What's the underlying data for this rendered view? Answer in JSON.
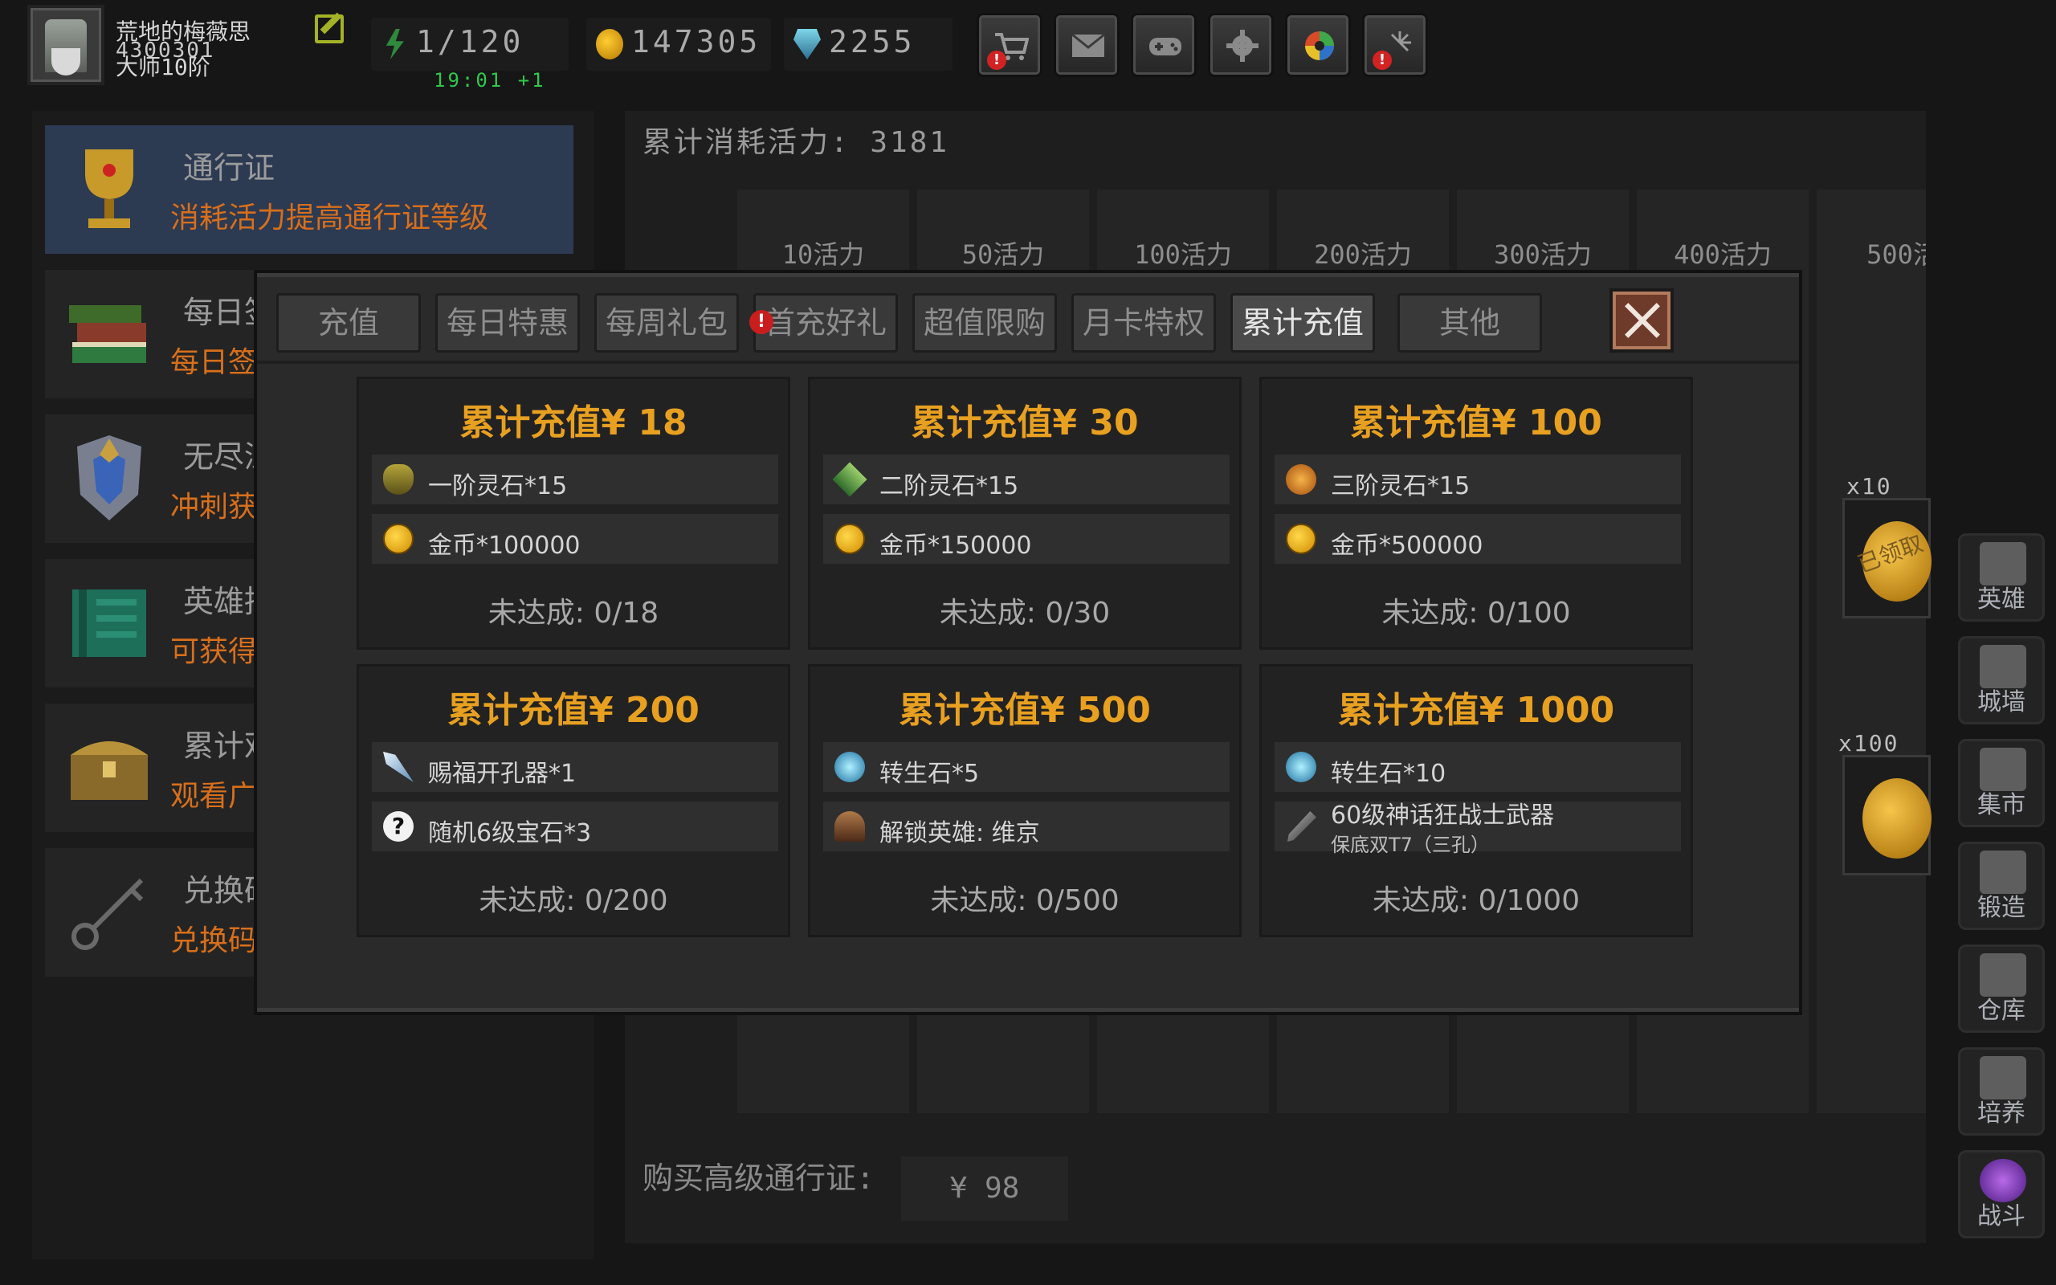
{
  "player": {
    "name": "荒地的梅薇思",
    "uid": "4300301",
    "rank": "大师10阶"
  },
  "resources": {
    "energy": "1/120",
    "energy_timer": "19:01 +1",
    "gold": "147305",
    "gems": "2255"
  },
  "top_buttons": [
    "shop",
    "mail",
    "gamepad",
    "settings",
    "aperture",
    "fireworks"
  ],
  "left_menu": [
    {
      "title": "通行证",
      "subtitle": "消耗活力提高通行证等级"
    },
    {
      "title": "每日签",
      "subtitle": "每日签"
    },
    {
      "title": "无尽深",
      "subtitle": "冲刺获"
    },
    {
      "title": "英雄招",
      "subtitle": "可获得"
    },
    {
      "title": "累计观",
      "subtitle": "观看广"
    },
    {
      "title": "兑换码",
      "subtitle": "兑换码"
    }
  ],
  "pass_panel": {
    "total_vitality": "累计消耗活力: 3181",
    "vitality_columns": [
      "10活力",
      "50活力",
      "100活力",
      "200活力",
      "300活力",
      "400活力",
      "500活"
    ],
    "buy_label": "购买高级通行证:",
    "buy_price": "¥ 98",
    "reward_counts": [
      "x10",
      "x100"
    ],
    "claimed_stamp": "已领取"
  },
  "sidebar": [
    "英雄",
    "城墙",
    "集市",
    "锻造",
    "仓库",
    "培养",
    "战斗"
  ],
  "modal": {
    "tabs": [
      "充值",
      "每日特惠",
      "每周礼包",
      "首充好礼",
      "超值限购",
      "月卡特权",
      "累计充值",
      "其他"
    ],
    "active_tab": "累计充值",
    "cards": [
      {
        "title": "累计充值¥ 18",
        "rewards": [
          {
            "icon": "stone-tier1-icon",
            "text": "一阶灵石*15"
          },
          {
            "icon": "gold-coin-icon",
            "text": "金币*100000"
          }
        ],
        "status": "未达成:  0/18"
      },
      {
        "title": "累计充值¥ 30",
        "rewards": [
          {
            "icon": "stone-tier2-icon",
            "text": "二阶灵石*15"
          },
          {
            "icon": "gold-coin-icon",
            "text": "金币*150000"
          }
        ],
        "status": "未达成:  0/30"
      },
      {
        "title": "累计充值¥ 100",
        "rewards": [
          {
            "icon": "stone-tier3-icon",
            "text": "三阶灵石*15"
          },
          {
            "icon": "gold-coin-icon",
            "text": "金币*500000"
          }
        ],
        "status": "未达成:  0/100"
      },
      {
        "title": "累计充值¥ 200",
        "rewards": [
          {
            "icon": "socket-drill-icon",
            "text": "赐福开孔器*1"
          },
          {
            "icon": "random-gem-icon",
            "text": "随机6级宝石*3"
          }
        ],
        "status": "未达成:  0/200"
      },
      {
        "title": "累计充值¥ 500",
        "rewards": [
          {
            "icon": "rebirth-stone-icon",
            "text": "转生石*5"
          },
          {
            "icon": "hero-unlock-icon",
            "text": "解锁英雄: 维京"
          }
        ],
        "status": "未达成:  0/500"
      },
      {
        "title": "累计充值¥ 1000",
        "rewards": [
          {
            "icon": "rebirth-stone-icon",
            "text": "转生石*10"
          },
          {
            "icon": "sword-icon",
            "text": "60级神话狂战士武器",
            "sub": "保底双T7（三孔）"
          }
        ],
        "status": "未达成:  0/1000"
      }
    ]
  }
}
